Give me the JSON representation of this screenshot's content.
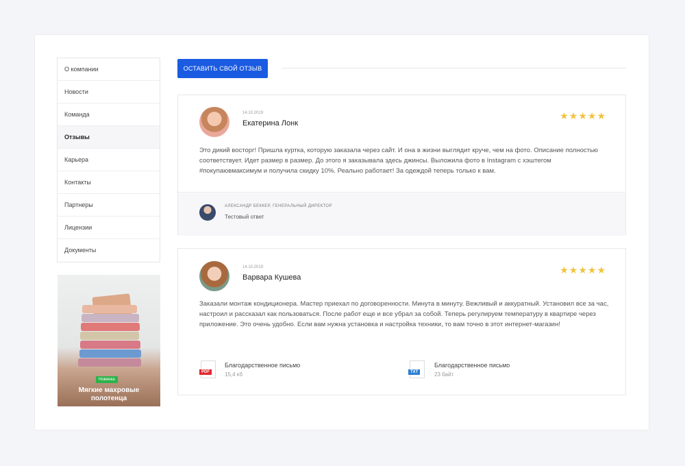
{
  "sidebar": {
    "items": [
      {
        "label": "О компании"
      },
      {
        "label": "Новости"
      },
      {
        "label": "Команда"
      },
      {
        "label": "Отзывы"
      },
      {
        "label": "Карьера"
      },
      {
        "label": "Контакты"
      },
      {
        "label": "Партнеры"
      },
      {
        "label": "Лицензии"
      },
      {
        "label": "Документы"
      }
    ],
    "active_index": 3
  },
  "promo": {
    "badge": "Новинка",
    "title": "Мягкие махровые полотенца"
  },
  "main": {
    "leave_review_label": "Оставить свой отзыв"
  },
  "reviews": [
    {
      "date": "14.10.2019",
      "author": "Екатерина Лонк",
      "rating": 5,
      "stars": "★★★★★",
      "text": "Это дикий восторг! Пришла куртка, которую заказала через сайт. И она в жизни выглядит круче, чем на фото. Описание полностью соответствует. Идет размер в размер. До этого я заказывала здесь джинсы. Выложила фото в Instagram с хэштегом #покупаювмаксимум и получила скидку 10%. Реально работает! За одеждой теперь только к вам.",
      "reply": {
        "name": "Александр Беккер, генеральный директор",
        "text": "Тестовый ответ"
      }
    },
    {
      "date": "14.10.2019",
      "author": "Варвара Кушева",
      "rating": 5,
      "stars": "★★★★★",
      "text": "Заказали монтаж кондиционера. Мастер приехал по договоренности. Минута в минуту. Вежливый и аккуратный. Установил все за час, настроил и рассказал как пользоваться. После работ еще и все убрал за собой. Теперь регулируем температуру в квартире через приложение. Это очень удобно. Если вам нужна установка и настройка техники, то вам точно в этот интернет-магазин!",
      "files": [
        {
          "type": "PDF",
          "name": "Благодарственное письмо",
          "size": "15,4 кб",
          "color": "#e0282e"
        },
        {
          "type": "TXT",
          "name": "Благодарственное письмо",
          "size": "23 байт",
          "color": "#2b7fd6"
        }
      ]
    }
  ],
  "colors": {
    "accent": "#1a5be1",
    "star": "#f0c33c",
    "badge": "#2cb34a"
  }
}
